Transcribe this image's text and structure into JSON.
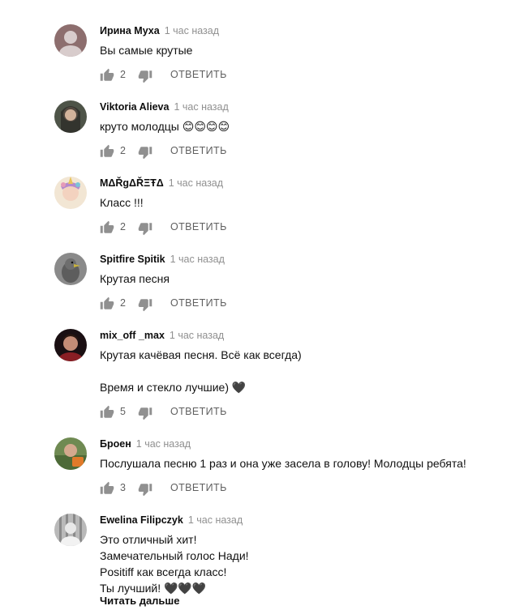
{
  "reply_label": "ОТВЕТИТЬ",
  "comments": [
    {
      "author": "Ирина Муха",
      "time": "1 час назад",
      "text": "Вы самые крутые",
      "likes": "2",
      "avatar": "avatar-placeholder-gray"
    },
    {
      "author": "Viktoria Alieva",
      "time": "1 час назад",
      "text": "круто молодцы 😊😊😊😊",
      "likes": "2",
      "avatar": "avatar-photo-girl-dark"
    },
    {
      "author": "MΔŘgΔŘΞŦΔ",
      "time": "1 час назад",
      "text": "Класс !!!",
      "likes": "2",
      "avatar": "avatar-photo-unicorn"
    },
    {
      "author": "Spitfire Spitik",
      "time": "1 час назад",
      "text": "Крутая песня",
      "likes": "2",
      "avatar": "avatar-photo-bird"
    },
    {
      "author": "mix_off _max",
      "time": "1 час назад",
      "text": "Крутая качёвая песня. Всё как всегда)\n\nВремя и стекло лучшие) 🖤",
      "likes": "5",
      "avatar": "avatar-photo-boy-dark"
    },
    {
      "author": "Броен",
      "time": "1 час назад",
      "text": "Послушала песню 1 раз и она уже засела в голову!  Молодцы ребята!",
      "likes": "3",
      "avatar": "avatar-photo-outdoor"
    },
    {
      "author": "Ewelina Filipczyk",
      "time": "1 час назад",
      "text": "Это отличный хит!\nЗамечательный голос Нади!\nPositiff как всегда класс!\nТы лучший! 🖤🖤🖤",
      "avatar": "avatar-photo-grayscale"
    }
  ],
  "read_more": "Читать дальше"
}
